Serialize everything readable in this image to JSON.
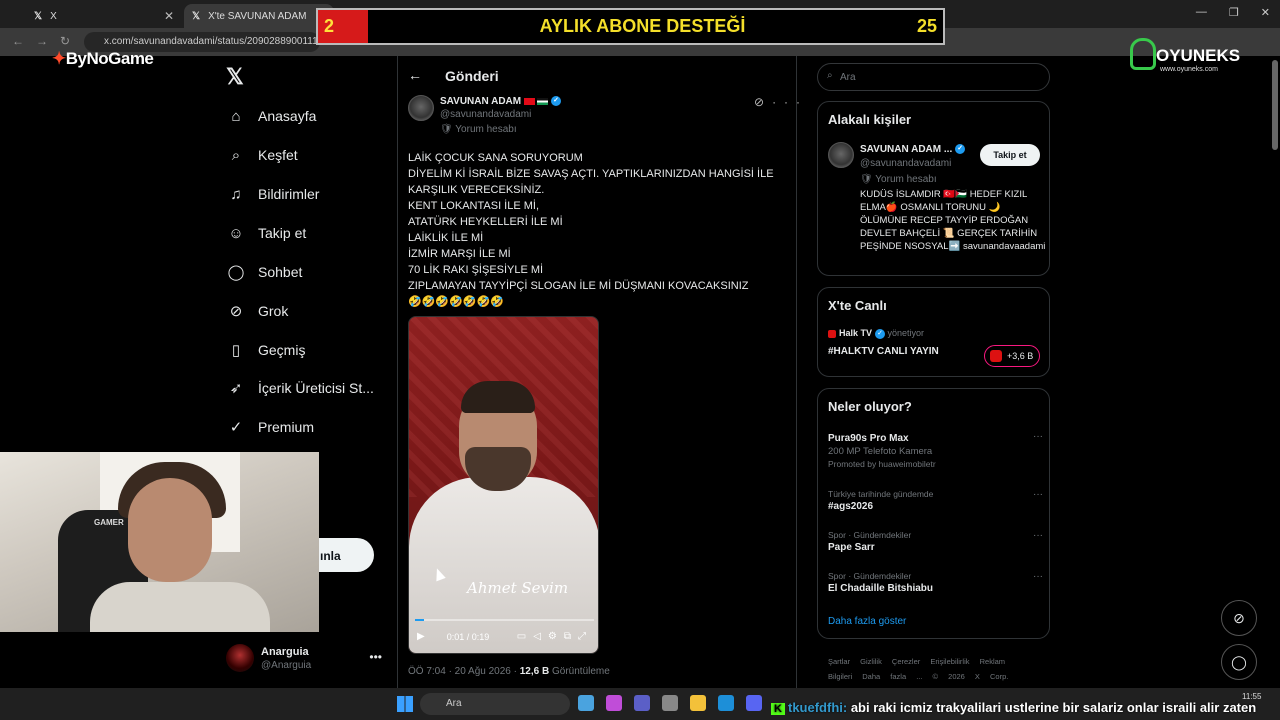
{
  "browser": {
    "tab1_title": "X",
    "tab2_title": "X'te SAVUNAN ADAM",
    "url": "x.com/savunandavadami/status/209028890011152"
  },
  "overlay": {
    "banner_left": "2",
    "banner_title": "AYLIK ABONE DESTEĞİ",
    "banner_right": "25",
    "bynogame": "ByNoGame",
    "oyuneks": "OYUNEKS",
    "oyuneks_sub": "www.oyuneks.com"
  },
  "nav": {
    "items": [
      {
        "label": "Anasayfa",
        "icon": "home-icon"
      },
      {
        "label": "Keşfet",
        "icon": "search-icon"
      },
      {
        "label": "Bildirimler",
        "icon": "bell-icon"
      },
      {
        "label": "Takip et",
        "icon": "follow-icon"
      },
      {
        "label": "Sohbet",
        "icon": "chat-icon"
      },
      {
        "label": "Grok",
        "icon": "grok-icon"
      },
      {
        "label": "Geçmiş",
        "icon": "bookmark-icon"
      },
      {
        "label": "İçerik Üreticisi St...",
        "icon": "rocket-icon"
      },
      {
        "label": "Premium",
        "icon": "premium-icon"
      }
    ],
    "post_button": "ınla"
  },
  "account": {
    "name": "Anarguia",
    "handle": "@Anarguia"
  },
  "post": {
    "header": "Gönderi",
    "author_name": "SAVUNAN ADAM",
    "author_handle": "@savunandavadami",
    "yorum": "Yorum hesabı",
    "lines": [
      "LAİK ÇOCUK SANA SORUYORUM",
      "DİYELİM Kİ İSRAİL BİZE SAVAŞ AÇTI. YAPTIKLARINIZDAN HANGİSİ İLE",
      "KARŞILIK VERECEKSİNİZ.",
      "KENT LOKANTASI İLE Mİ,",
      "ATATÜRK HEYKELLERİ İLE Mİ",
      "LAİKLİK İLE Mİ",
      "İZMİR MARŞI İLE Mİ",
      "70 LİK RAKI ŞİŞESİYLE Mİ",
      "ZIPLAMAYAN TAYYİPÇİ SLOGAN İLE Mİ DÜŞMANI KOVACAKSINIZ",
      "🤣🤣🤣🤣🤣🤣🤣"
    ],
    "video_signature": "Ahmet Sevim",
    "video_time": "0:01 / 0:19",
    "video_progress": 0.05,
    "meta_time": "ÖÖ 7:04 · 20 Ağu 2026 · ",
    "meta_views": "12,6 B",
    "meta_views_label": " Görüntüleme"
  },
  "right": {
    "search_placeholder": "Ara",
    "people_title": "Alakalı kişiler",
    "person_name": "SAVUNAN ADAM ...",
    "person_handle": "@savunandavadami",
    "follow_label": "Takip et",
    "person_yorum": "Yorum hesabı",
    "person_bio": "KUDÜS İSLAMDIR 🇹🇷🇵🇸 HEDEF KIZIL ELMA🍎 OSMANLI TORUNU 🌙 ÖLÜMÜNE RECEP TAYYİP ERDOĞAN DEVLET BAHÇELİ 📜 GERÇEK TARİHİN PEŞİNDE NSOSYAL➡️ savunandavaadami",
    "live_title": "X'te Canlı",
    "live_source": "Halk TV",
    "live_role": " yönetiyor",
    "live_show": "#HALKTV CANLI YAYIN",
    "live_count": "+3,6 B",
    "trends_title": "Neler oluyor?",
    "trends": [
      {
        "cat": "",
        "title": "Pura90s Pro Max",
        "sub": "200 MP Telefoto Kamera",
        "promo": "Promoted by huaweimobiletr"
      },
      {
        "cat": "Türkiye tarihinde gündemde",
        "title": "#ags2026",
        "sub": "",
        "promo": ""
      },
      {
        "cat": "Spor · Gündemdekiler",
        "title": "Pape Sarr",
        "sub": "",
        "promo": ""
      },
      {
        "cat": "Spor · Gündemdekiler",
        "title": "El Chadaille Bitshiabu",
        "sub": "",
        "promo": ""
      }
    ],
    "more_link": "Daha fazla göster",
    "footer": "Şartlar Gizlilik Çerezler Erişilebilirlik Reklam Bilgileri Daha fazla ... © 2026 X Corp."
  },
  "taskbar": {
    "search": "Ara",
    "clock": "11:55"
  },
  "chat": {
    "nick": "tkuefdfhi:",
    "message": " abi raki icmiz trakyalilari ustlerine bir salariz onlar israili alir zaten"
  },
  "colors": {
    "accent": "#1d9bf0",
    "banner_red": "#d61a1a",
    "banner_yellow": "#f4df2a"
  }
}
